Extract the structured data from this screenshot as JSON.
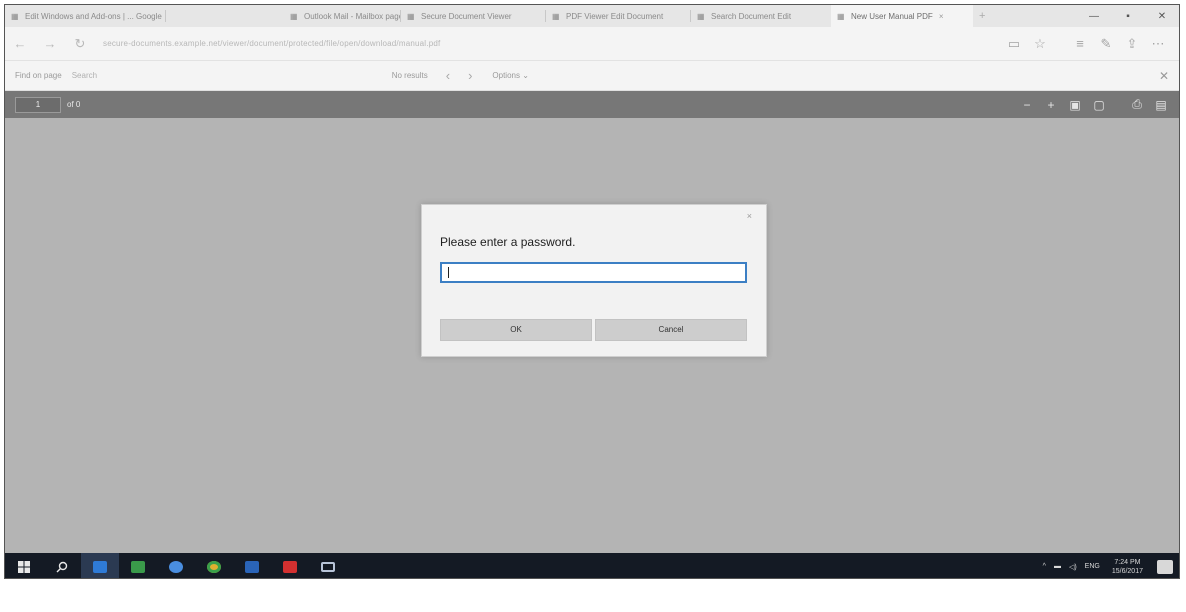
{
  "tabs": [
    {
      "label": "Edit Windows and Add-ons | ... Google",
      "active": false
    },
    {
      "label": "Outlook Mail - Mailbox page",
      "active": false
    },
    {
      "label": "Secure Document Viewer",
      "active": false
    },
    {
      "label": "PDF Viewer Edit Document",
      "active": false
    },
    {
      "label": "Search Document Edit",
      "active": false
    },
    {
      "label": "New User Manual PDF",
      "active": true
    }
  ],
  "window_controls": {
    "minimize": "—",
    "maximize": "▪",
    "close": "✕"
  },
  "address_bar": {
    "url": "secure-documents.example.net/viewer/document/protected/file/open/download/manual.pdf",
    "back": "←",
    "forward": "→",
    "refresh": "↻"
  },
  "find_bar": {
    "label": "Find on page",
    "input_placeholder": "Search",
    "results": "No results",
    "prev": "‹",
    "next": "›",
    "options": "Options ⌄",
    "close": "✕"
  },
  "pdf_toolbar": {
    "page_value": "1",
    "page_total": "of 0"
  },
  "dialog": {
    "message": "Please enter a password.",
    "close": "×",
    "ok_label": "OK",
    "cancel_label": "Cancel",
    "password_value": ""
  },
  "taskbar": {
    "clock_time": "7:24 PM",
    "clock_date": "15/6/2017",
    "lang": "ENG",
    "apps": [
      {
        "name": "edge",
        "color": "#2f7bd6"
      },
      {
        "name": "files",
        "color": "#3a9a4a"
      },
      {
        "name": "globe",
        "color": "#4a8ee0"
      },
      {
        "name": "chrome",
        "color": "#e0b030"
      },
      {
        "name": "outlook",
        "color": "#2a64b8"
      },
      {
        "name": "acrobat",
        "color": "#d33030"
      },
      {
        "name": "tablet",
        "color": "#b8c4d8"
      }
    ]
  }
}
